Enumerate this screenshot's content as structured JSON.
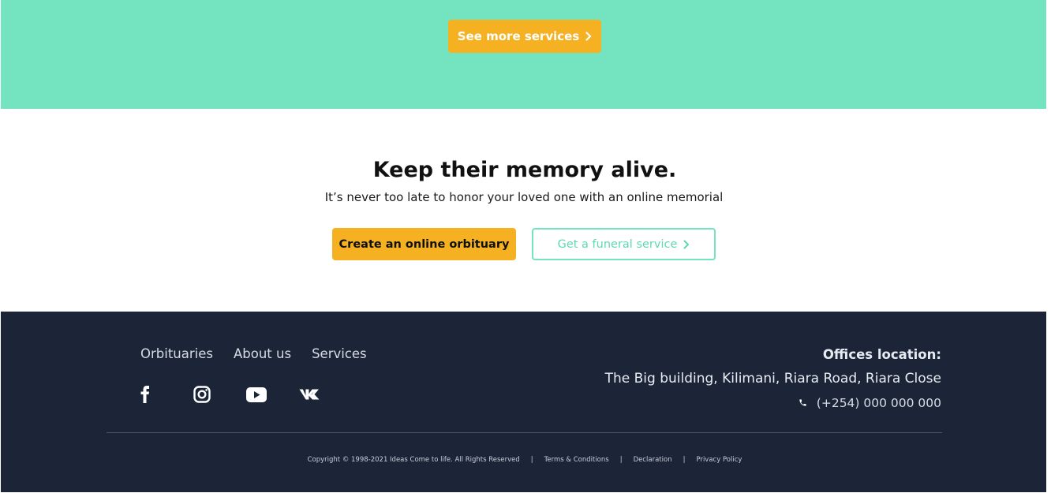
{
  "services_band": {
    "see_more_label": "See more services"
  },
  "cta": {
    "title": "Keep their memory alive.",
    "subtitle": "It’s never too late to honor your loved one with an online memorial",
    "create_label": "Create an online orbituary",
    "funeral_label": "Get a funeral service"
  },
  "footer": {
    "nav": [
      "Orbituaries",
      "About us",
      "Services"
    ],
    "social_icons": [
      "facebook-icon",
      "instagram-icon",
      "youtube-icon",
      "vk-icon"
    ],
    "offices_label": "Offices location:",
    "address": "The Big building, Kilimani, Riara Road, Riara Close",
    "phone": "(+254) 000 000 000",
    "copyright": "Copyright © 1998-2021 Ideas Come to life. All Rights Reserved",
    "legal_links": [
      "Terms & Conditions",
      "Declaration",
      "Privacy Policy"
    ],
    "separator": "|"
  },
  "colors": {
    "teal": "#74e3c0",
    "amber": "#f5b122",
    "footer_bg": "#1c2538"
  }
}
